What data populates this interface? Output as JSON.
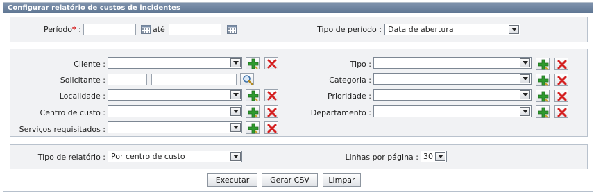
{
  "window": {
    "title": "Configurar relatório de custos de incidentes"
  },
  "period": {
    "label": "Período",
    "required_mark": "*",
    "start_value": "",
    "separator": "até",
    "end_value": "",
    "type_label": "Tipo de período",
    "type_selected": "Data de abertura"
  },
  "filters": {
    "cliente": {
      "label": "Cliente",
      "selected": ""
    },
    "solicitante": {
      "label": "Solicitante",
      "code_value": "",
      "name_value": ""
    },
    "localidade": {
      "label": "Localidade",
      "selected": ""
    },
    "centro_custo": {
      "label": "Centro de custo",
      "selected": ""
    },
    "servicos": {
      "label": "Serviços requisitados",
      "selected": ""
    },
    "tipo": {
      "label": "Tipo",
      "selected": ""
    },
    "categoria": {
      "label": "Categoria",
      "selected": ""
    },
    "prioridade": {
      "label": "Prioridade",
      "selected": ""
    },
    "departamento": {
      "label": "Departamento",
      "selected": ""
    }
  },
  "report": {
    "type_label": "Tipo de relatório",
    "type_selected": "Por centro de custo",
    "lines_label": "Linhas por página",
    "lines_selected": "30"
  },
  "actions": {
    "execute": "Executar",
    "csv": "Gerar CSV",
    "clear": "Limpar"
  },
  "colors": {
    "titlebar": "#6b819d",
    "panel": "#f1f2f4",
    "required": "#d10000",
    "add_icon": "#2f9a2f",
    "remove_icon": "#d42020"
  },
  "icons": {
    "calendar": "calendar-icon",
    "add": "add-icon",
    "remove": "remove-icon",
    "search": "search-icon",
    "dropdown": "chevron-down-icon"
  }
}
